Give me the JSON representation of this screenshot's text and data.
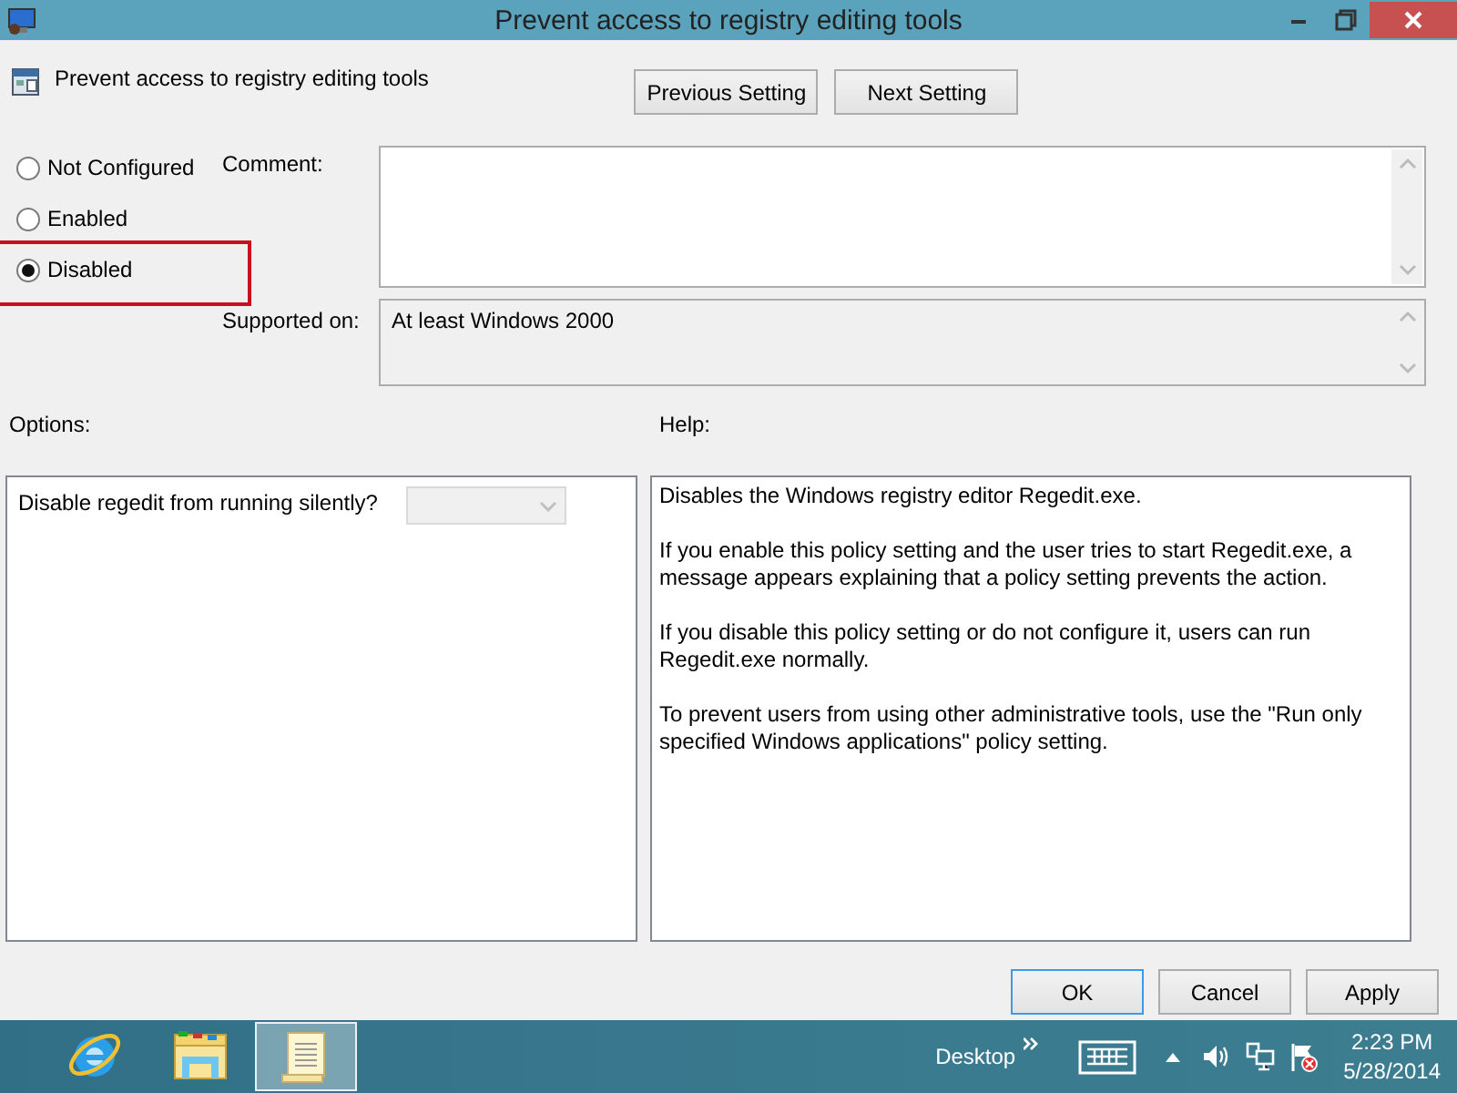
{
  "window": {
    "title": "Prevent access to registry editing tools"
  },
  "policy": {
    "name": "Prevent access to registry editing tools"
  },
  "nav_buttons": [
    "Previous Setting",
    "Next Setting"
  ],
  "state_options": [
    {
      "label": "Not Configured",
      "selected": false,
      "highlighted": false
    },
    {
      "label": "Enabled",
      "selected": false,
      "highlighted": false
    },
    {
      "label": "Disabled",
      "selected": true,
      "highlighted": true
    }
  ],
  "comment": {
    "label": "Comment:"
  },
  "supported_on": {
    "label": "Supported on:",
    "value": "At least Windows 2000"
  },
  "options": {
    "label": "Options:",
    "items": [
      {
        "kind": "dropdown",
        "label": "Disable regedit from running silently?",
        "disabled": true
      }
    ]
  },
  "help": {
    "label": "Help:",
    "paragraphs": [
      "Disables the Windows registry editor Regedit.exe.",
      "If you enable this policy setting and the user tries to start Regedit.exe, a message appears explaining that a policy setting prevents the action.",
      "If you disable this policy setting or do not configure it, users can run Regedit.exe normally.",
      "To prevent users from using other administrative tools, use the \"Run only specified Windows applications\" policy setting."
    ]
  },
  "buttons": [
    {
      "label": "OK",
      "default": true
    },
    {
      "label": "Cancel",
      "default": false
    },
    {
      "label": "Apply",
      "default": false
    }
  ],
  "taskbar": {
    "apps": [
      {
        "kind": "browser",
        "selected": false
      },
      {
        "kind": "folder",
        "selected": false
      },
      {
        "kind": "scroll",
        "selected": true
      }
    ],
    "desktop_label": "Desktop",
    "time": "2:23 PM",
    "date": "5/28/2014"
  }
}
